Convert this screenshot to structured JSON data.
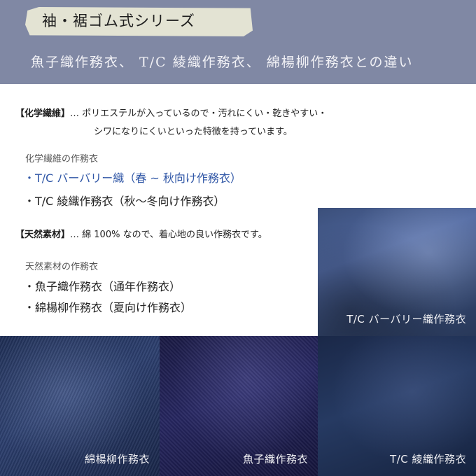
{
  "banner": {
    "series_tag": "袖・裾ゴム式シリーズ",
    "subtitle": "魚子織作務衣、 T/C 綾織作務衣、 綿楊柳作務衣との違い"
  },
  "chemical": {
    "label": "【化学繊維】",
    "desc_line1": "… ポリエステルが入っているので・汚れにくい・乾きやすい・",
    "desc_line2": "シワになりにくいといった特徴を持っています。",
    "sub_head": "化学繊維の作務衣",
    "items": [
      "・T/C バーバリー織（春 ~ 秋向け作務衣）",
      "・T/C 綾織作務衣（秋〜冬向け作務衣）"
    ]
  },
  "natural": {
    "label": "【天然素材】",
    "desc": "… 綿 100% なので、着心地の良い作務衣です。",
    "sub_head": "天然素材の作務衣",
    "items": [
      "・魚子織作務衣（通年作務衣）",
      "・綿楊柳作務衣（夏向け作務衣）"
    ]
  },
  "swatches": {
    "barberry": "T/C バーバリー織作務衣",
    "cotton_yoryu": "綿楊柳作務衣",
    "nanako": "魚子織作務衣",
    "twill": "T/C 綾織作務衣"
  },
  "colors": {
    "banner": "#8088a4",
    "highlight": "#2f56a6"
  }
}
